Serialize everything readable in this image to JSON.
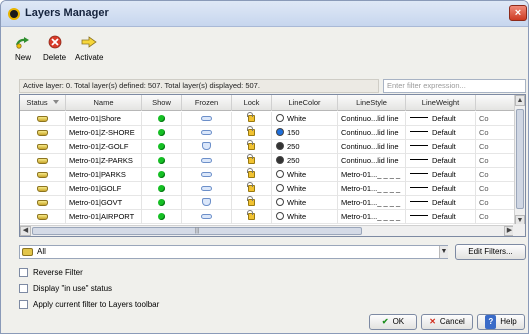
{
  "window": {
    "title": "Layers Manager",
    "close_glyph": "×"
  },
  "toolbar": {
    "new_label": "New",
    "delete_label": "Delete",
    "activate_label": "Activate",
    "new_icon": "new-layer-icon",
    "delete_icon": "delete-icon",
    "activate_icon": "activate-arrow-icon"
  },
  "status_text": "Active layer: 0. Total layer(s) defined: 507. Total layer(s) displayed: 507.",
  "filter_input": {
    "placeholder": "Enter filter expression..."
  },
  "columns": {
    "status": "Status",
    "name": "Name",
    "show": "Show",
    "frozen": "Frozen",
    "lock": "Lock",
    "linecolor": "LineColor",
    "linestyle": "LineStyle",
    "lineweight": "LineWeight",
    "extra": ""
  },
  "rows": [
    {
      "name": "Metro-01|Shore",
      "color_name": "White",
      "swatch": "#ffffff",
      "linestyle": "Continuo...lid line",
      "lineweight": "Default",
      "extra": "Co",
      "frozen": "frozen"
    },
    {
      "name": "Metro-01|Z-SHORE",
      "color_name": "150",
      "swatch": "#1e6fdc",
      "linestyle": "Continuo...lid line",
      "lineweight": "Default",
      "extra": "Co",
      "frozen": "frozen"
    },
    {
      "name": "Metro-01|Z-GOLF",
      "color_name": "250",
      "swatch": "#333333",
      "linestyle": "Continuo...lid line",
      "lineweight": "Default",
      "extra": "Co",
      "frozen": "thawed"
    },
    {
      "name": "Metro-01|Z-PARKS",
      "color_name": "250",
      "swatch": "#333333",
      "linestyle": "Continuo...lid line",
      "lineweight": "Default",
      "extra": "Co",
      "frozen": "frozen"
    },
    {
      "name": "Metro-01|PARKS",
      "color_name": "White",
      "swatch": "#ffffff",
      "linestyle": "Metro-01..._ _ _ _",
      "lineweight": "Default",
      "extra": "Co",
      "frozen": "frozen"
    },
    {
      "name": "Metro-01|GOLF",
      "color_name": "White",
      "swatch": "#ffffff",
      "linestyle": "Metro-01..._ _ _ _",
      "lineweight": "Default",
      "extra": "Co",
      "frozen": "frozen"
    },
    {
      "name": "Metro-01|GOVT",
      "color_name": "White",
      "swatch": "#ffffff",
      "linestyle": "Metro-01..._ _ _ _",
      "lineweight": "Default",
      "extra": "Co",
      "frozen": "thawed"
    },
    {
      "name": "Metro-01|AIRPORT",
      "color_name": "White",
      "swatch": "#ffffff",
      "linestyle": "Metro-01..._ _ _ _",
      "lineweight": "Default",
      "extra": "Co",
      "frozen": "frozen"
    }
  ],
  "filter_select": {
    "value": "All"
  },
  "edit_filters_label": "Edit Filters...",
  "checkboxes": {
    "reverse": "Reverse Filter",
    "in_use": "Display \"in use\" status",
    "apply_toolbar": "Apply current filter to Layers toolbar"
  },
  "buttons": {
    "ok": "OK",
    "cancel": "Cancel",
    "help": "Help",
    "ok_glyph": "✔",
    "cancel_glyph": "✕",
    "help_glyph": "?"
  },
  "colors": {
    "accent": "#c7d6ee",
    "show_on": "#15c024",
    "close_red": "#cc3a22"
  }
}
